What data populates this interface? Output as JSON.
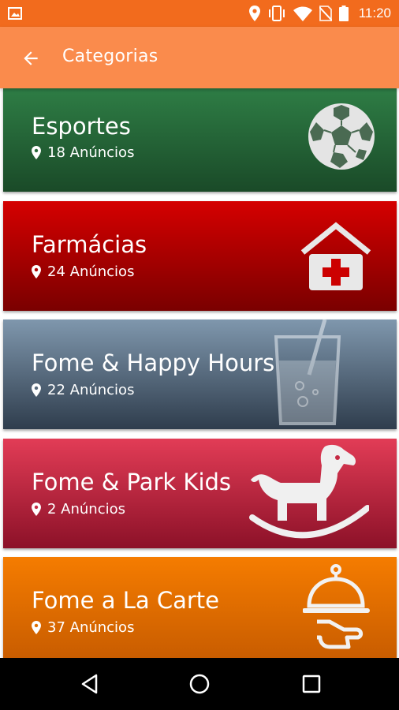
{
  "status_bar": {
    "time": "11:20",
    "icons": [
      "image-icon",
      "location-icon",
      "vibrate-icon",
      "wifi-icon",
      "no-sim-icon",
      "battery-icon"
    ]
  },
  "app_bar": {
    "title": "Categorias",
    "back_icon": "arrow-back-icon"
  },
  "categories": [
    {
      "name": "Esportes",
      "count": "18 Anúncios",
      "icon": "soccer-ball-icon",
      "color_top": "#2e7d45",
      "color_bottom": "#1a4a28"
    },
    {
      "name": "Farmácias",
      "count": "24 Anúncios",
      "icon": "pharmacy-house-icon",
      "color_top": "#d50000",
      "color_bottom": "#7a0000"
    },
    {
      "name": "Fome & Happy Hours",
      "count": "22 Anúncios",
      "icon": "drink-glass-icon",
      "color_top": "#7f97ad",
      "color_bottom": "#2f3d4d"
    },
    {
      "name": "Fome & Park Kids",
      "count": "2 Anúncios",
      "icon": "rocking-horse-icon",
      "color_top": "#e23c56",
      "color_bottom": "#8c1128"
    },
    {
      "name": "Fome a La Carte",
      "count": "37 Anúncios",
      "icon": "serving-cloche-icon",
      "color_top": "#f57c00",
      "color_bottom": "#c55a00"
    }
  ],
  "nav_bar": {
    "back": "nav-back-icon",
    "home": "nav-home-icon",
    "recents": "nav-recents-icon"
  }
}
